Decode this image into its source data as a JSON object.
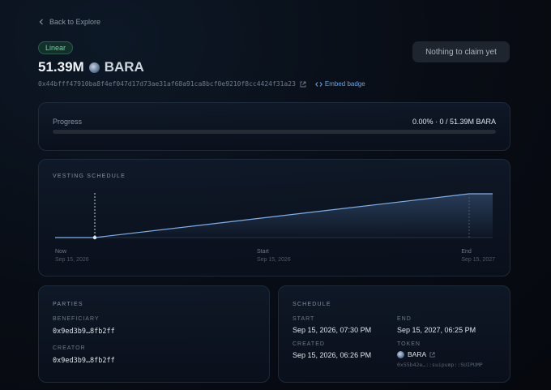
{
  "nav": {
    "back_label": "Back to Explore"
  },
  "header": {
    "badge": "Linear",
    "amount": "51.39M",
    "token_symbol": "BARA",
    "address": "0x44bfff47910ba8f4ef047d17d73ae31af68a91ca8bcf0e9210f8cc4424f31a23",
    "embed_label": "Embed badge",
    "claim_label": "Nothing to claim yet"
  },
  "progress": {
    "label": "Progress",
    "value_text": "0.00% · 0 / 51.39M BARA",
    "percent": 0
  },
  "vesting": {
    "title": "VESTING SCHEDULE",
    "markers": [
      {
        "label": "Now",
        "date": "Sep 15, 2026"
      },
      {
        "label": "Start",
        "date": "Sep 15, 2026"
      },
      {
        "label": "End",
        "date": "Sep 15, 2027"
      }
    ]
  },
  "parties": {
    "title": "PARTIES",
    "beneficiary_label": "BENEFICIARY",
    "beneficiary": "0x9ed3b9…8fb2ff",
    "creator_label": "CREATOR",
    "creator": "0x9ed3b9…8fb2ff"
  },
  "schedule": {
    "title": "SCHEDULE",
    "start_label": "START",
    "start": "Sep 15, 2026, 07:30 PM",
    "end_label": "END",
    "end": "Sep 15, 2027, 06:25 PM",
    "created_label": "CREATED",
    "created": "Sep 15, 2026, 06:26 PM",
    "token_label": "TOKEN",
    "token_symbol": "BARA",
    "token_type": "0x55b42e…::suipump::SUIPUMP"
  },
  "colors": {
    "accent": "#6aa3e8",
    "badge": "#6fd1a3"
  }
}
